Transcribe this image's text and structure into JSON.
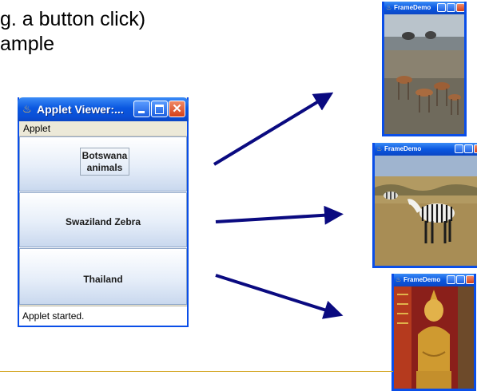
{
  "slide": {
    "line1": "g. a button click)",
    "line2": "ample"
  },
  "applet_window": {
    "title": "Applet Viewer:...",
    "menu": [
      "Applet"
    ],
    "buttons": [
      "Botswana animals",
      "Swaziland Zebra",
      "Thailand"
    ],
    "status": "Applet started."
  },
  "frames": [
    {
      "title": "FrameDemo",
      "content": "antelope-elephants-photo"
    },
    {
      "title": "FrameDemo",
      "content": "zebra-photo"
    },
    {
      "title": "FrameDemo",
      "content": "golden-buddha-photo"
    }
  ],
  "colors": {
    "arrow": "#0a0a80",
    "title_bar": "#0a57e0",
    "rule": "#d4a827"
  }
}
